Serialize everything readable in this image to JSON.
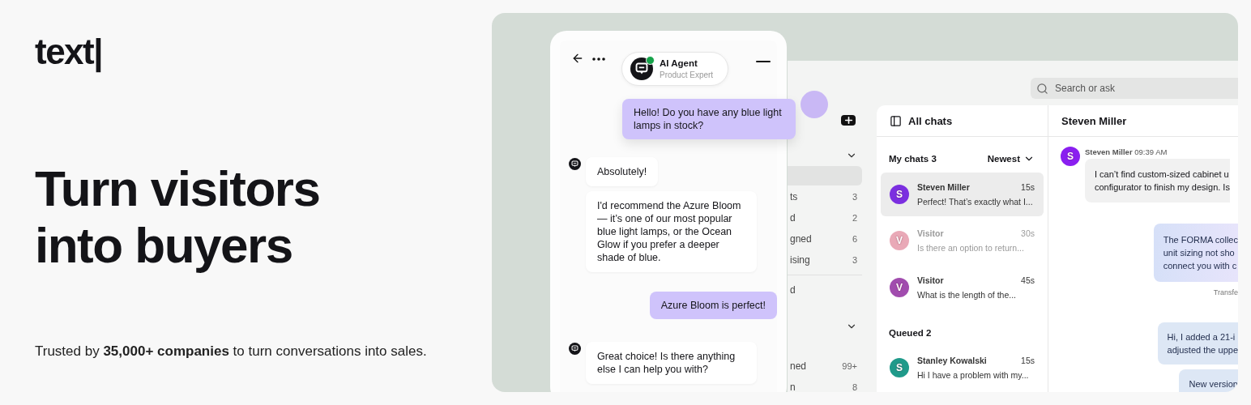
{
  "logo": "text|",
  "headline": "Turn visitors into buyers",
  "tagline": "Trusted by **35,000+ companies** to turn conversations into sales.",
  "widget": {
    "agent_name": "AI Agent",
    "agent_role": "Product Expert",
    "online": true,
    "messages": [
      {
        "kind": "visitor",
        "text": "Hello! Do you have any blue light lamps in stock?"
      },
      {
        "kind": "agent",
        "text": "Absolutely!"
      },
      {
        "kind": "agent",
        "text": "I'd recommend the Azure Bloom — it’s one of our most popular blue light lamps, or the Ocean Glow if you prefer a deeper shade of blue."
      },
      {
        "kind": "visitor",
        "text": "Azure Bloom is perfect!"
      },
      {
        "kind": "agent",
        "text": "Great choice! Is there anything else I can help you with?"
      }
    ]
  },
  "app": {
    "search": {
      "placeholder": "Search or ask"
    },
    "sidebar": {
      "sections": [
        {
          "expanded": true,
          "items": [
            {
              "selected": true
            },
            {
              "label": "ts",
              "count": "3",
              "selected": false
            },
            {
              "label": "d",
              "count": "2",
              "selected": false
            },
            {
              "label": "gned",
              "count": "6",
              "selected": false
            },
            {
              "label": "ising",
              "count": "3",
              "selected": false
            }
          ]
        },
        {
          "items": [
            {
              "label": "d",
              "selected": false
            }
          ]
        },
        {
          "expanded": true,
          "items": [
            {
              "label": "ned",
              "count": "99+",
              "selected": false
            },
            {
              "label": "n",
              "count": "8",
              "selected": false
            }
          ]
        }
      ]
    },
    "chat_list": {
      "title": "All chats",
      "groups": [
        {
          "label": "My chats 3",
          "sort": "Newest",
          "chats": [
            {
              "initial": "S",
              "color": "#7b2fe0",
              "name": "Steven Miller",
              "time": "15s",
              "preview": "Perfect! That’s exactly what I...",
              "selected": true,
              "faded": false
            },
            {
              "initial": "V",
              "color": "#e9a9b7",
              "name": "Visitor",
              "time": "30s",
              "preview": "Is there an option to return...",
              "selected": false,
              "faded": true
            },
            {
              "initial": "V",
              "color": "#a14cae",
              "name": "Visitor",
              "time": "45s",
              "preview": "What is the length of the...",
              "selected": false,
              "faded": false
            }
          ]
        },
        {
          "label": "Queued 2",
          "chats": [
            {
              "initial": "S",
              "color": "#1f9a8a",
              "name": "Stanley Kowalski",
              "time": "15s",
              "preview": "Hi I have a problem with my...",
              "selected": false,
              "faded": false
            }
          ]
        }
      ]
    },
    "conversation": {
      "title": "Steven Miller",
      "messages": [
        {
          "kind": "customer",
          "initial": "S",
          "color": "#8a1ff0",
          "author": "Steven Miller",
          "time": "09:39 AM",
          "text": "I can’t find custom-sized cabinet u\nconfigurator to finish my design. Is"
        },
        {
          "kind": "agent",
          "text": "The FORMA collec\nunit sizing not sho\nconnect you with c"
        },
        {
          "kind": "system",
          "text": "Transfe"
        },
        {
          "kind": "agent",
          "text": "Hi, I added a 21-i\nadjusted the uppe"
        },
        {
          "kind": "agent",
          "text": "New version"
        }
      ]
    }
  }
}
